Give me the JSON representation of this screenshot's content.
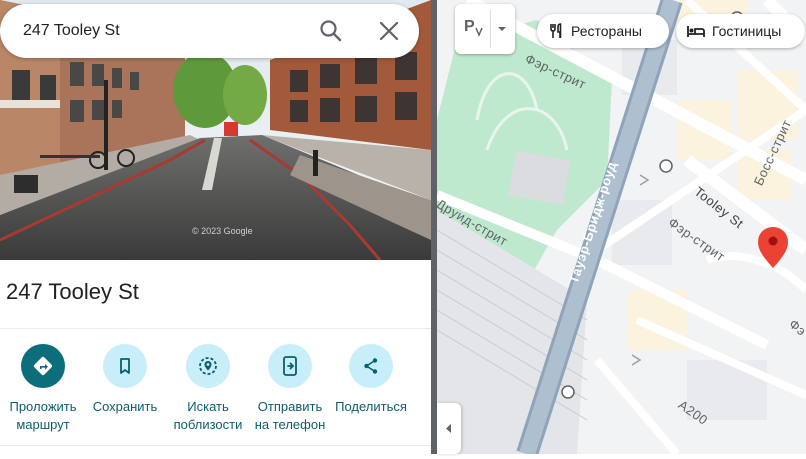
{
  "search": {
    "query": "247 Tooley St"
  },
  "place": {
    "title": "247 Tooley St",
    "photo_watermark": "© 2023 Google"
  },
  "actions": [
    {
      "line1": "Проложить",
      "line2": "маршрут",
      "icon": "directions-icon"
    },
    {
      "line1": "Сохранить",
      "line2": "",
      "icon": "bookmark-icon"
    },
    {
      "line1": "Искать",
      "line2": "поблизости",
      "icon": "nearby-icon"
    },
    {
      "line1": "Отправить",
      "line2": "на телефон",
      "icon": "send-to-phone-icon"
    },
    {
      "line1": "Поделиться",
      "line2": "",
      "icon": "share-icon"
    }
  ],
  "map": {
    "layers_label": "Р",
    "chips": {
      "restaurants": "Рестораны",
      "hotels": "Гостиницы"
    },
    "streets": {
      "fair_street_1": "Фэр-стрит",
      "fair_street_2": "Фэр-стрит",
      "tooley": "Tooley St",
      "boss": "Босс-стрит",
      "druid": "Друид-стрит",
      "tower_bridge": "Тауэр-Бридж-роуд",
      "a200": "A200",
      "edge": "Фэ"
    }
  },
  "colors": {
    "accent": "#0b6e7a",
    "action_bg": "#c8eefa",
    "pin": "#ea4335",
    "park": "#bfe9cf"
  }
}
